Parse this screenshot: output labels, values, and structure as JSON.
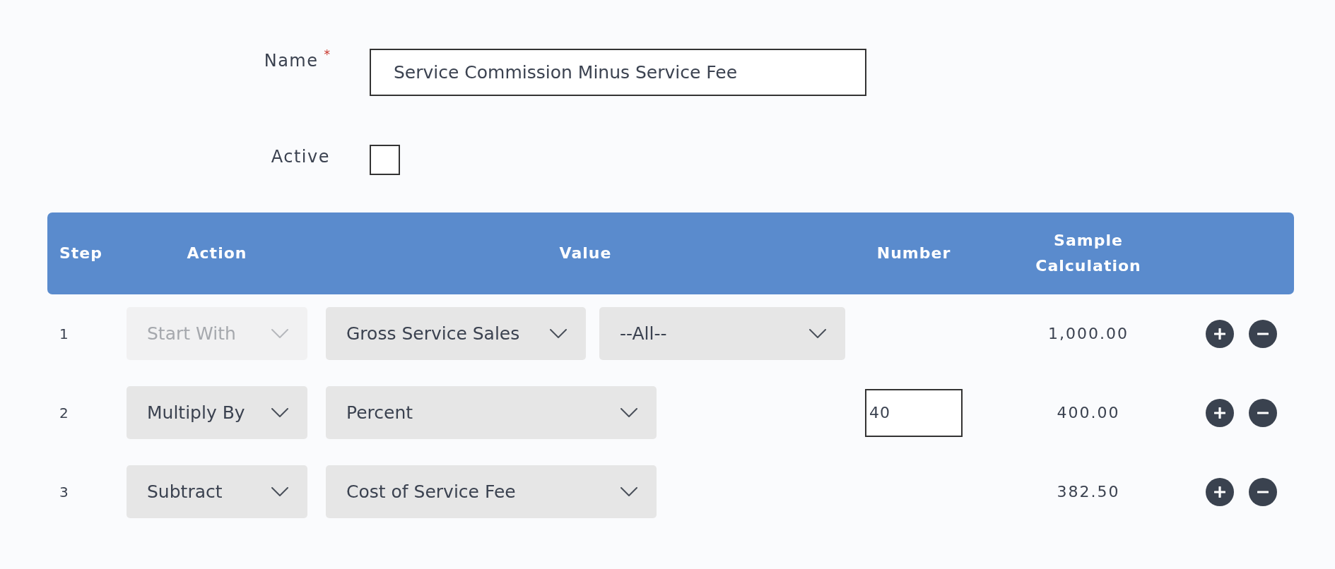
{
  "form": {
    "name": {
      "label": "Name",
      "required_mark": "*",
      "value": "Service Commission Minus Service Fee"
    },
    "active": {
      "label": "Active",
      "checked": false
    }
  },
  "table": {
    "columns": [
      "Step",
      "Action",
      "Value",
      "Number",
      "Sample Calculation"
    ],
    "rows": [
      {
        "step": "1",
        "action": {
          "value": "Start With",
          "disabled": true
        },
        "values": [
          {
            "value": "Gross Service Sales"
          },
          {
            "value": "--All--"
          }
        ],
        "sample": "1,000.00"
      },
      {
        "step": "2",
        "action": {
          "value": "Multiply By",
          "disabled": false
        },
        "values": [
          {
            "value": "Percent"
          }
        ],
        "number": "40",
        "sample": "400.00"
      },
      {
        "step": "3",
        "action": {
          "value": "Subtract",
          "disabled": false
        },
        "values": [
          {
            "value": "Cost of Service Fee"
          }
        ],
        "sample": "382.50"
      }
    ]
  }
}
